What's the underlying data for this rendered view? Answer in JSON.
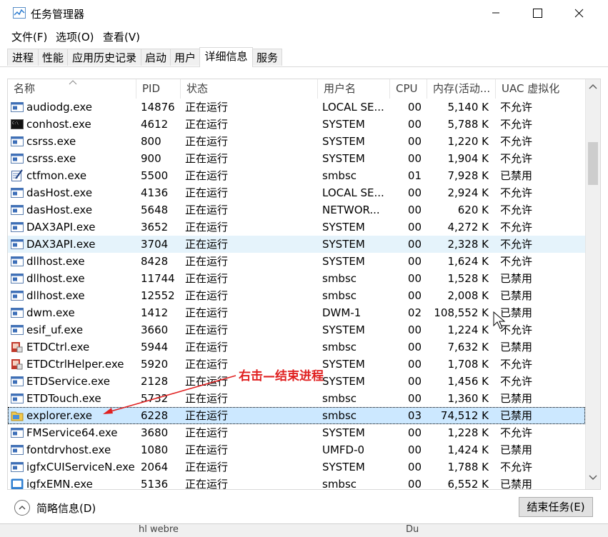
{
  "window": {
    "title": "任务管理器",
    "icon": "task-manager-icon",
    "controls": [
      "minimize-icon",
      "maximize-icon",
      "close-icon"
    ]
  },
  "menu": [
    "文件(F)",
    "选项(O)",
    "查看(V)"
  ],
  "tabs": [
    {
      "label": "进程",
      "active": false
    },
    {
      "label": "性能",
      "active": false
    },
    {
      "label": "应用历史记录",
      "active": false
    },
    {
      "label": "启动",
      "active": false
    },
    {
      "label": "用户",
      "active": false
    },
    {
      "label": "详细信息",
      "active": true
    },
    {
      "label": "服务",
      "active": false
    }
  ],
  "columns": [
    "名称",
    "PID",
    "状态",
    "用户名",
    "CPU",
    "内存(活动...",
    "UAC 虚拟化"
  ],
  "rows": [
    {
      "name": "audiodg.exe",
      "pid": "14876",
      "status": "正在运行",
      "user": "LOCAL SE...",
      "cpu": "00",
      "mem": "5,140 K",
      "uac": "不允许",
      "icon": "exe-window-icon"
    },
    {
      "name": "conhost.exe",
      "pid": "4612",
      "status": "正在运行",
      "user": "SYSTEM",
      "cpu": "00",
      "mem": "5,788 K",
      "uac": "不允许",
      "icon": "console-icon"
    },
    {
      "name": "csrss.exe",
      "pid": "800",
      "status": "正在运行",
      "user": "SYSTEM",
      "cpu": "00",
      "mem": "1,220 K",
      "uac": "不允许",
      "icon": "exe-window-icon"
    },
    {
      "name": "csrss.exe",
      "pid": "900",
      "status": "正在运行",
      "user": "SYSTEM",
      "cpu": "00",
      "mem": "1,904 K",
      "uac": "不允许",
      "icon": "exe-window-icon"
    },
    {
      "name": "ctfmon.exe",
      "pid": "5500",
      "status": "正在运行",
      "user": "smbsc",
      "cpu": "01",
      "mem": "7,928 K",
      "uac": "已禁用",
      "icon": "pen-notepad-icon"
    },
    {
      "name": "dasHost.exe",
      "pid": "4136",
      "status": "正在运行",
      "user": "LOCAL SE...",
      "cpu": "00",
      "mem": "2,924 K",
      "uac": "不允许",
      "icon": "exe-window-icon"
    },
    {
      "name": "dasHost.exe",
      "pid": "5648",
      "status": "正在运行",
      "user": "NETWOR...",
      "cpu": "00",
      "mem": "620 K",
      "uac": "不允许",
      "icon": "exe-window-icon"
    },
    {
      "name": "DAX3API.exe",
      "pid": "3652",
      "status": "正在运行",
      "user": "SYSTEM",
      "cpu": "00",
      "mem": "4,272 K",
      "uac": "不允许",
      "icon": "exe-window-icon"
    },
    {
      "name": "DAX3API.exe",
      "pid": "3704",
      "status": "正在运行",
      "user": "SYSTEM",
      "cpu": "00",
      "mem": "2,328 K",
      "uac": "不允许",
      "icon": "exe-window-icon"
    },
    {
      "name": "dllhost.exe",
      "pid": "8428",
      "status": "正在运行",
      "user": "SYSTEM",
      "cpu": "00",
      "mem": "1,624 K",
      "uac": "不允许",
      "icon": "exe-window-icon"
    },
    {
      "name": "dllhost.exe",
      "pid": "11744",
      "status": "正在运行",
      "user": "smbsc",
      "cpu": "00",
      "mem": "1,528 K",
      "uac": "已禁用",
      "icon": "exe-window-icon"
    },
    {
      "name": "dllhost.exe",
      "pid": "12552",
      "status": "正在运行",
      "user": "smbsc",
      "cpu": "00",
      "mem": "2,008 K",
      "uac": "已禁用",
      "icon": "exe-window-icon"
    },
    {
      "name": "dwm.exe",
      "pid": "1412",
      "status": "正在运行",
      "user": "DWM-1",
      "cpu": "02",
      "mem": "108,552 K",
      "uac": "已禁用",
      "icon": "exe-window-icon"
    },
    {
      "name": "esif_uf.exe",
      "pid": "3660",
      "status": "正在运行",
      "user": "SYSTEM",
      "cpu": "00",
      "mem": "1,224 K",
      "uac": "不允许",
      "icon": "exe-window-icon"
    },
    {
      "name": "ETDCtrl.exe",
      "pid": "5944",
      "status": "正在运行",
      "user": "smbsc",
      "cpu": "00",
      "mem": "7,632 K",
      "uac": "已禁用",
      "icon": "touchpad-icon"
    },
    {
      "name": "ETDCtrlHelper.exe",
      "pid": "5920",
      "status": "正在运行",
      "user": "SYSTEM",
      "cpu": "00",
      "mem": "1,708 K",
      "uac": "不允许",
      "icon": "touchpad-icon"
    },
    {
      "name": "ETDService.exe",
      "pid": "2128",
      "status": "正在运行",
      "user": "SYSTEM",
      "cpu": "00",
      "mem": "1,456 K",
      "uac": "不允许",
      "icon": "exe-window-icon"
    },
    {
      "name": "ETDTouch.exe",
      "pid": "5732",
      "status": "正在运行",
      "user": "smbsc",
      "cpu": "00",
      "mem": "1,360 K",
      "uac": "已禁用",
      "icon": "exe-window-icon"
    },
    {
      "name": "explorer.exe",
      "pid": "6228",
      "status": "正在运行",
      "user": "smbsc",
      "cpu": "03",
      "mem": "74,512 K",
      "uac": "已禁用",
      "icon": "folder-icon"
    },
    {
      "name": "FMService64.exe",
      "pid": "3680",
      "status": "正在运行",
      "user": "SYSTEM",
      "cpu": "00",
      "mem": "1,228 K",
      "uac": "不允许",
      "icon": "exe-window-icon"
    },
    {
      "name": "fontdrvhost.exe",
      "pid": "1080",
      "status": "正在运行",
      "user": "UMFD-0",
      "cpu": "00",
      "mem": "1,424 K",
      "uac": "已禁用",
      "icon": "exe-window-icon"
    },
    {
      "name": "igfxCUIServiceN.exe",
      "pid": "2064",
      "status": "正在运行",
      "user": "SYSTEM",
      "cpu": "00",
      "mem": "1,788 K",
      "uac": "不允许",
      "icon": "exe-window-icon"
    },
    {
      "name": "igfxEMN.exe",
      "pid": "5136",
      "status": "正在运行",
      "user": "smbsc",
      "cpu": "00",
      "mem": "6,552 K",
      "uac": "已禁用",
      "icon": "graphics-icon"
    }
  ],
  "hovered_row": 8,
  "selected_row": 18,
  "footer": {
    "fewer_details": "简略信息(D)",
    "end_task": "结束任务(E)"
  },
  "background": {
    "partial_text_1": "hl webre",
    "partial_text_2": "Du"
  },
  "annotation": {
    "text": "右击—结束进程",
    "color": "#e02020"
  }
}
